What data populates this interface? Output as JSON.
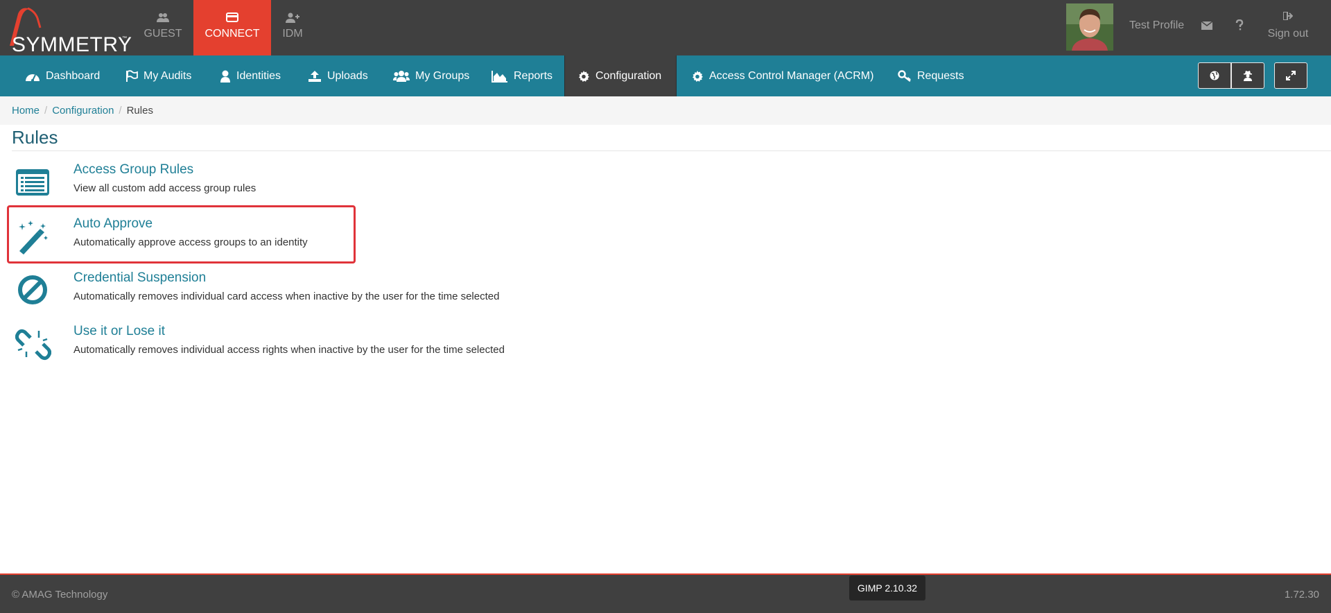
{
  "logo": {
    "text": "SYMMETRY",
    "tm": "™"
  },
  "app_tabs": [
    {
      "label": "GUEST",
      "icon": "users-icon"
    },
    {
      "label": "CONNECT",
      "icon": "card-icon"
    },
    {
      "label": "IDM",
      "icon": "user-plus-icon"
    }
  ],
  "profile": {
    "name": "Test Profile",
    "signout_label": "Sign out"
  },
  "nav": [
    {
      "label": "Dashboard",
      "icon": "dashboard-icon"
    },
    {
      "label": "My Audits",
      "icon": "flag-icon"
    },
    {
      "label": "Identities",
      "icon": "user-icon"
    },
    {
      "label": "Uploads",
      "icon": "upload-icon"
    },
    {
      "label": "My Groups",
      "icon": "users-icon"
    },
    {
      "label": "Reports",
      "icon": "area-chart-icon"
    },
    {
      "label": "Configuration",
      "icon": "gear-icon"
    },
    {
      "label": "Access Control Manager (ACRM)",
      "icon": "gear-icon"
    },
    {
      "label": "Requests",
      "icon": "key-icon"
    }
  ],
  "breadcrumb": {
    "home": "Home",
    "configuration": "Configuration",
    "current": "Rules",
    "separator": "/"
  },
  "page": {
    "title": "Rules"
  },
  "rules": [
    {
      "title": "Access Group Rules",
      "description": "View all custom add access group rules",
      "icon": "list-icon"
    },
    {
      "title": "Auto Approve",
      "description": "Automatically approve access groups to an identity",
      "icon": "magic-wand-icon"
    },
    {
      "title": "Credential Suspension",
      "description": "Automatically removes individual card access when inactive by the user for the time selected",
      "icon": "ban-icon"
    },
    {
      "title": "Use it or Lose it",
      "description": "Automatically removes individual access rights when inactive by the user for the time selected",
      "icon": "unlink-icon"
    }
  ],
  "footer": {
    "copyright": "© AMAG Technology",
    "version": "1.72.30"
  },
  "tooltip": {
    "text": "GIMP 2.10.32"
  },
  "colors": {
    "topbar": "#404040",
    "accent_red": "#e4402f",
    "nav_teal": "#1f7f96",
    "link_teal": "#1f7f96",
    "highlight_red": "#e0333a"
  }
}
